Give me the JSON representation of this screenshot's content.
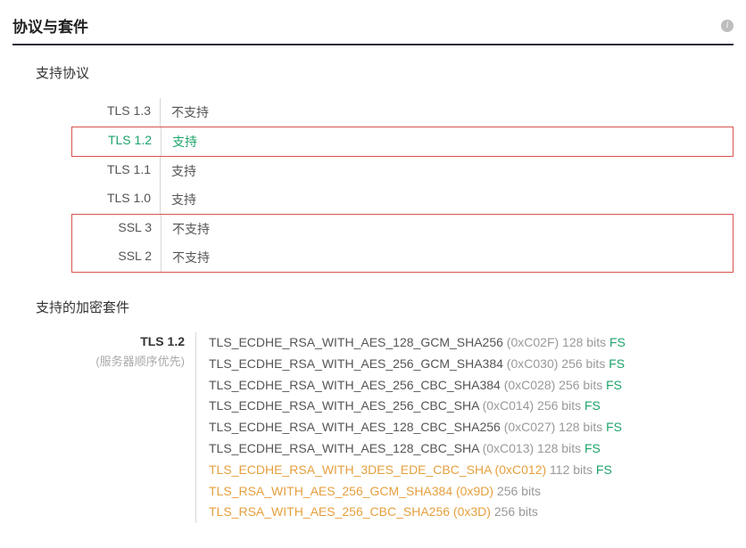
{
  "section_title": "协议与套件",
  "info_icon_glyph": "i",
  "protocols": {
    "heading": "支持协议",
    "rows": [
      {
        "label": "TLS 1.3",
        "value": "不支持",
        "hl": "",
        "box": ""
      },
      {
        "label": "TLS 1.2",
        "value": "支持",
        "hl": "green",
        "box": "single"
      },
      {
        "label": "TLS 1.1",
        "value": "支持",
        "hl": "",
        "box": ""
      },
      {
        "label": "TLS 1.0",
        "value": "支持",
        "hl": "",
        "box": ""
      },
      {
        "label": "SSL 3",
        "value": "不支持",
        "hl": "",
        "box": "top"
      },
      {
        "label": "SSL 2",
        "value": "不支持",
        "hl": "",
        "box": "bottom"
      }
    ]
  },
  "ciphers": {
    "heading": "支持的加密套件",
    "version": "TLS 1.2",
    "order_note": "(服务器顺序优先)",
    "list": [
      {
        "name": "TLS_ECDHE_RSA_WITH_AES_128_GCM_SHA256",
        "code": "(0xC02F)",
        "bits": "128 bits",
        "fs": "FS",
        "weak": false
      },
      {
        "name": "TLS_ECDHE_RSA_WITH_AES_256_GCM_SHA384",
        "code": "(0xC030)",
        "bits": "256 bits",
        "fs": "FS",
        "weak": false
      },
      {
        "name": "TLS_ECDHE_RSA_WITH_AES_256_CBC_SHA384",
        "code": "(0xC028)",
        "bits": "256 bits",
        "fs": "FS",
        "weak": false
      },
      {
        "name": "TLS_ECDHE_RSA_WITH_AES_256_CBC_SHA",
        "code": "(0xC014)",
        "bits": "256 bits",
        "fs": "FS",
        "weak": false
      },
      {
        "name": "TLS_ECDHE_RSA_WITH_AES_128_CBC_SHA256",
        "code": "(0xC027)",
        "bits": "128 bits",
        "fs": "FS",
        "weak": false
      },
      {
        "name": "TLS_ECDHE_RSA_WITH_AES_128_CBC_SHA",
        "code": "(0xC013)",
        "bits": "128 bits",
        "fs": "FS",
        "weak": false
      },
      {
        "name": "TLS_ECDHE_RSA_WITH_3DES_EDE_CBC_SHA",
        "code": "(0xC012)",
        "bits": "112 bits",
        "fs": "FS",
        "weak": true
      },
      {
        "name": "TLS_RSA_WITH_AES_256_GCM_SHA384",
        "code": "(0x9D)",
        "bits": "256 bits",
        "fs": "",
        "weak": true
      },
      {
        "name": "TLS_RSA_WITH_AES_256_CBC_SHA256",
        "code": "(0x3D)",
        "bits": "256 bits",
        "fs": "",
        "weak": true
      }
    ]
  }
}
